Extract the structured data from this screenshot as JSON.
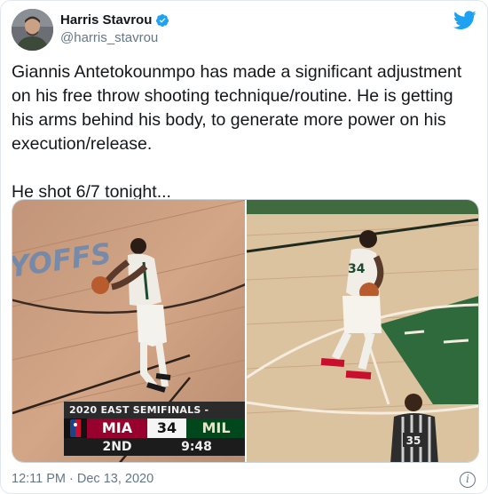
{
  "author": {
    "name": "Harris Stavrou",
    "handle": "@harris_stavrou",
    "verified": true,
    "avatar_icon": "person-avatar"
  },
  "brand": {
    "logo_icon": "twitter-bird-icon",
    "color": "#1da1f2"
  },
  "tweet": {
    "paragraph1": "Giannis Antetokounmpo has made a significant adjustment on his free throw shooting technique/routine. He is getting his arms behind his body, to generate more power on his execution/release.",
    "paragraph2": "He shot 6/7 tonight..."
  },
  "media": {
    "left_image": {
      "court_text": "YOFFS",
      "scoreboard": {
        "title": "2020 EAST SEMIFINALS -",
        "team1": "MIA",
        "score": "34",
        "team2": "MIL",
        "quarter": "2ND",
        "clock": "9:48"
      }
    },
    "right_image": {
      "player_jersey": "34",
      "referee_number": "35"
    }
  },
  "footer": {
    "timestamp": "12:11 PM · Dec 13, 2020",
    "info_icon": "info-icon"
  }
}
